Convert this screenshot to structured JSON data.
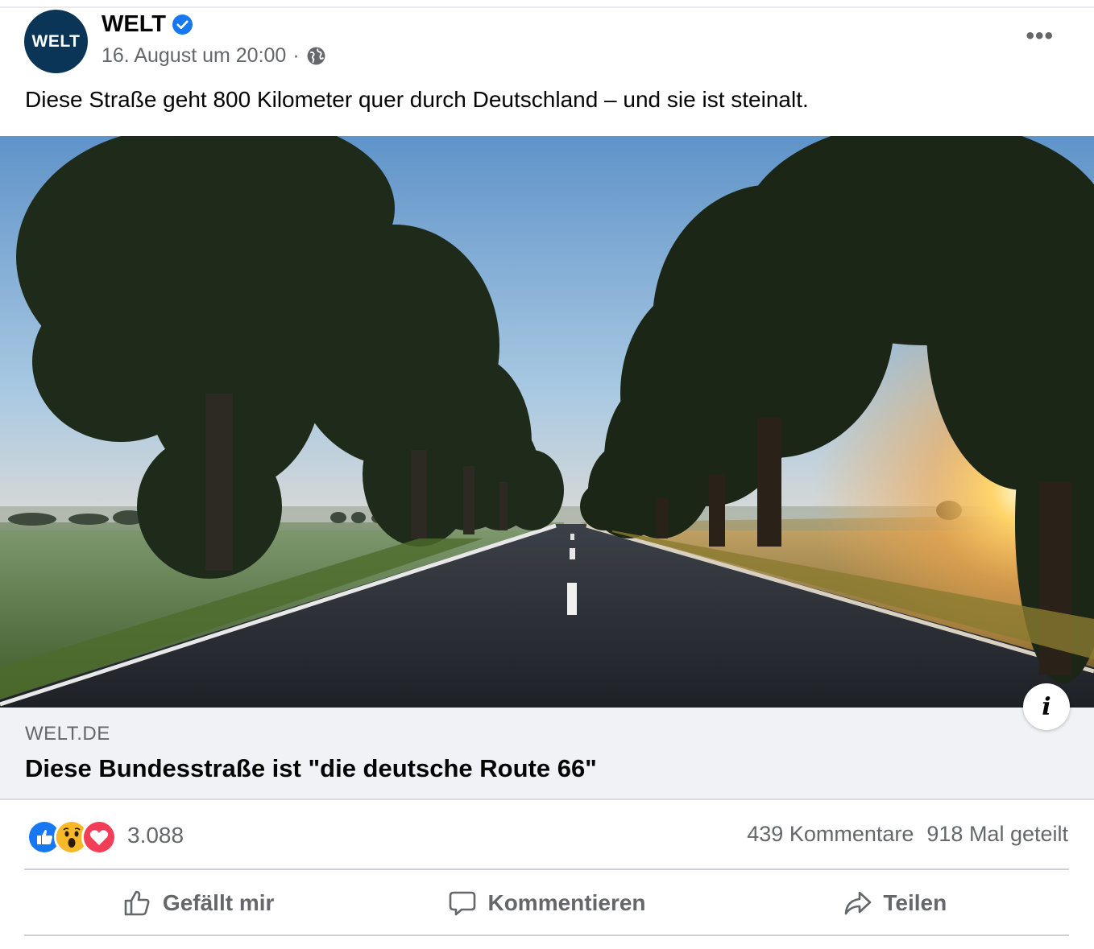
{
  "post": {
    "avatar_text": "WELT",
    "page_name": "WELT",
    "verified": true,
    "timestamp": "16. August um 20:00",
    "separator": "·",
    "privacy_icon": "globe-icon",
    "more_label": "•••",
    "text": "Diese Straße geht 800 Kilometer quer durch Deutschland – und sie ist steinalt."
  },
  "link_preview": {
    "domain": "WELT.DE",
    "headline": "Diese Bundesstraße ist \"die deutsche Route 66\"",
    "info_label": "i",
    "image_description_icon": "road-photo"
  },
  "engagement": {
    "reaction_icons": [
      "like-icon",
      "wow-icon",
      "love-icon"
    ],
    "reaction_count": "3.088",
    "comments": "439 Kommentare",
    "shares": "918 Mal geteilt"
  },
  "actions": {
    "like": "Gefällt mir",
    "comment": "Kommentieren",
    "share": "Teilen"
  },
  "colors": {
    "brand": "#0b3557",
    "facebook_blue": "#1877f2",
    "secondary_text": "#65676b",
    "link_bg": "#f0f2f5"
  }
}
